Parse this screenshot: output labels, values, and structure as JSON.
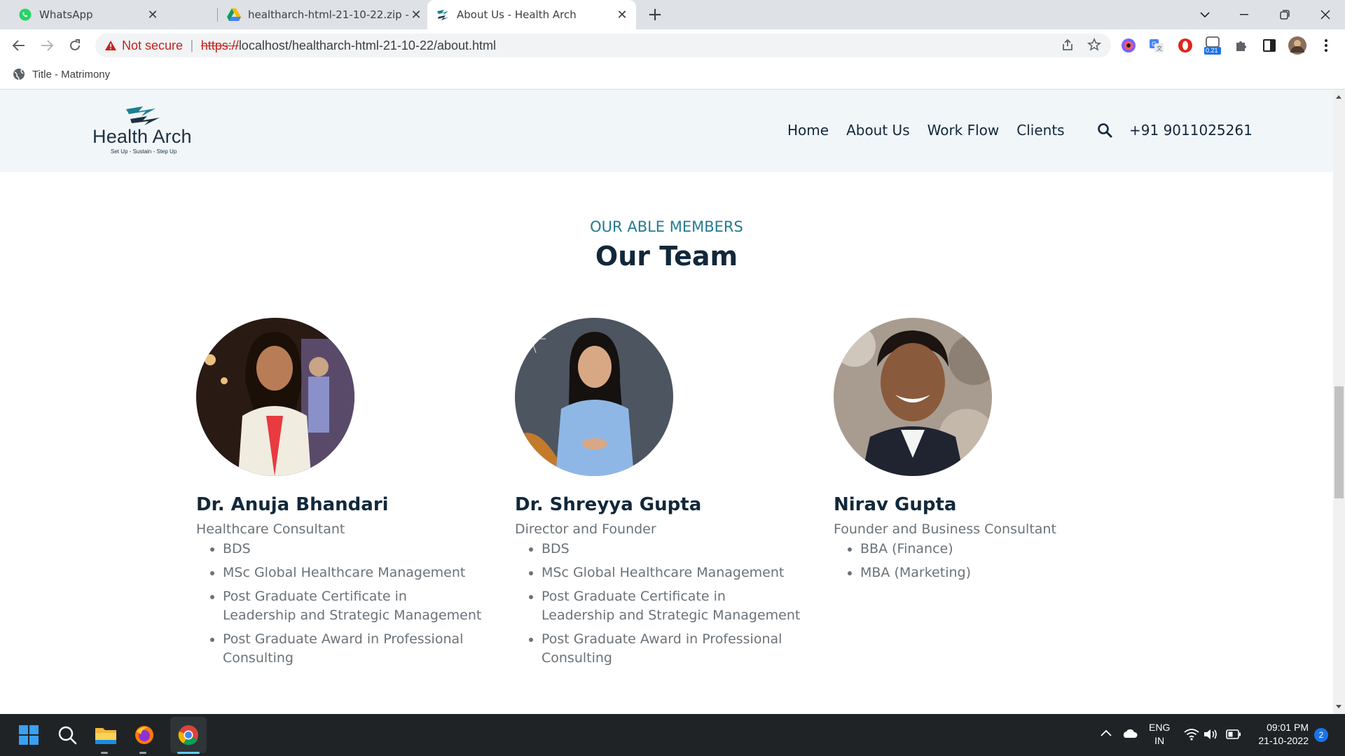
{
  "browser": {
    "tabs": [
      {
        "title": "WhatsApp",
        "icon": "whatsapp-icon"
      },
      {
        "title": "healtharch-html-21-10-22.zip - G",
        "icon": "google-drive-icon"
      },
      {
        "title": "About Us - Health Arch",
        "icon": "health-arch-favicon",
        "active": true
      }
    ],
    "new_tab": "+",
    "security_label": "Not secure",
    "url_scheme": "https://",
    "url_rest": "localhost/healtharch-html-21-10-22/about.html",
    "extension_badge": "0.21",
    "bookmark": "Title - Matrimony"
  },
  "site": {
    "logo_name": "Health Arch",
    "logo_tagline": "Set Up - Sustain - Step Up",
    "nav": [
      "Home",
      "About Us",
      "Work Flow",
      "Clients"
    ],
    "phone": "+91 9011025261"
  },
  "section": {
    "subtitle": "OUR ABLE MEMBERS",
    "title": "Our Team"
  },
  "members": [
    {
      "name": "Dr. Anuja Bhandari",
      "role": "Healthcare Consultant",
      "qualifications": [
        "BDS",
        "MSc Global Healthcare Management",
        "Post Graduate Certificate in Leadership and Strategic Management",
        "Post Graduate Award in Professional Consulting"
      ]
    },
    {
      "name": "Dr. Shreyya Gupta",
      "role": "Director and Founder",
      "qualifications": [
        "BDS",
        "MSc Global Healthcare Management",
        "Post Graduate Certificate in Leadership and Strategic Management",
        "Post Graduate Award in Professional Consulting"
      ]
    },
    {
      "name": "Nirav Gupta",
      "role": "Founder and Business Consultant",
      "qualifications": [
        "BBA (Finance)",
        "MBA (Marketing)"
      ]
    }
  ],
  "taskbar": {
    "language": "ENG",
    "region": "IN",
    "time": "09:01 PM",
    "date": "21-10-2022",
    "notification_count": "2"
  }
}
